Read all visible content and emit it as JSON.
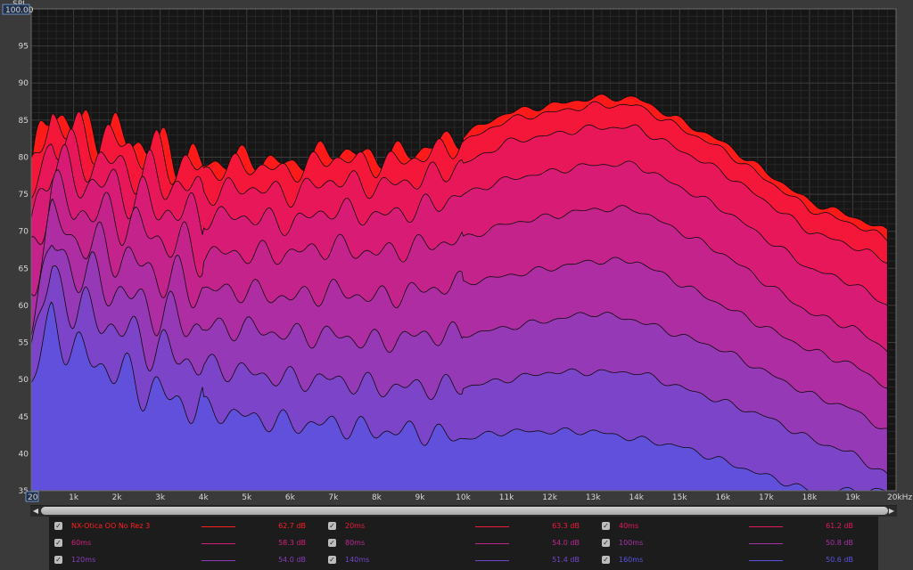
{
  "chart_data": {
    "type": "area",
    "ylabel": "SPL",
    "ylim": [
      35,
      100
    ],
    "xlim": [
      20,
      20000
    ],
    "y_ticks": [
      "100.00",
      "95",
      "90",
      "85",
      "80",
      "75",
      "70",
      "65",
      "60",
      "55",
      "50",
      "45",
      "40",
      "35"
    ],
    "x_ticks": [
      "20",
      "1k",
      "2k",
      "3k",
      "4k",
      "5k",
      "6k",
      "7k",
      "8k",
      "9k",
      "10k",
      "11k",
      "12k",
      "13k",
      "14k",
      "15k",
      "16k",
      "17k",
      "18k",
      "19k",
      "20kHz"
    ],
    "grid": true,
    "x": [
      20,
      500,
      1000,
      2000,
      3000,
      4000,
      5000,
      6000,
      7000,
      8000,
      9000,
      10000,
      11000,
      12000,
      13000,
      14000,
      15000,
      16000,
      17000,
      18000,
      19000,
      19800
    ],
    "series": [
      {
        "name": "NX-Otica OO No Rez 3",
        "color": "#ff1a1a",
        "values": [
          78,
          87,
          84,
          83,
          81,
          79,
          80,
          79,
          81,
          80,
          81,
          83,
          86,
          87,
          88,
          88,
          85,
          82,
          78,
          74,
          72,
          70
        ]
      },
      {
        "name": "20ms",
        "color": "#f5173a",
        "values": [
          77,
          86,
          83,
          82,
          80,
          78,
          79,
          78,
          80,
          79,
          80,
          82,
          85,
          86,
          87,
          87,
          84,
          81,
          77,
          73,
          71,
          69
        ]
      },
      {
        "name": "40ms",
        "color": "#e8175a",
        "values": [
          74,
          83,
          80,
          79,
          77,
          75,
          76,
          75,
          77,
          76,
          77,
          79,
          82,
          83,
          84,
          84,
          81,
          78,
          74,
          70,
          68,
          66
        ]
      },
      {
        "name": "60ms",
        "color": "#d81c75",
        "values": [
          71,
          80,
          77,
          76,
          73,
          72,
          72,
          71,
          73,
          72,
          73,
          75,
          77,
          78,
          79,
          79,
          76,
          73,
          69,
          65,
          63,
          60
        ]
      },
      {
        "name": "80ms",
        "color": "#c5238c",
        "values": [
          67,
          76,
          73,
          72,
          69,
          67,
          67,
          67,
          68,
          67,
          68,
          69,
          71,
          72,
          73,
          73,
          70,
          67,
          63,
          59,
          57,
          54
        ]
      },
      {
        "name": "100ms",
        "color": "#ae2da2",
        "values": [
          63,
          72,
          69,
          67,
          64,
          62,
          62,
          61,
          62,
          61,
          62,
          63,
          64,
          65,
          66,
          66,
          63,
          60,
          57,
          54,
          52,
          49
        ]
      },
      {
        "name": "120ms",
        "color": "#9639b6",
        "values": [
          59,
          68,
          65,
          62,
          59,
          57,
          57,
          56,
          56,
          55,
          56,
          56,
          57,
          58,
          59,
          58,
          56,
          54,
          51,
          48,
          46,
          43
        ]
      },
      {
        "name": "140ms",
        "color": "#7c44c9",
        "values": [
          55,
          64,
          60,
          57,
          54,
          52,
          51,
          50,
          50,
          49,
          49,
          49,
          50,
          51,
          51,
          51,
          49,
          47,
          45,
          42,
          40,
          37
        ]
      },
      {
        "name": "160ms",
        "color": "#6150dc",
        "values": [
          50,
          58,
          54,
          51,
          48,
          46,
          45,
          44,
          44,
          43,
          43,
          42,
          43,
          43,
          43,
          42,
          41,
          39,
          37,
          35,
          35,
          35
        ]
      }
    ]
  },
  "legend": [
    {
      "name": "NX-Otica OO No Rez 3",
      "value": "62.7 dB",
      "color": "#ff2020",
      "checked": "✓"
    },
    {
      "name": "20ms",
      "value": "63.3 dB",
      "color": "#f21a3d",
      "checked": "✓"
    },
    {
      "name": "40ms",
      "value": "61.2 dB",
      "color": "#e31a5c",
      "checked": "✓"
    },
    {
      "name": "60ms",
      "value": "58.3 dB",
      "color": "#d0207a",
      "checked": "✓"
    },
    {
      "name": "80ms",
      "value": "54.0 dB",
      "color": "#bb2890",
      "checked": "✓"
    },
    {
      "name": "100ms",
      "value": "50.8 dB",
      "color": "#a532a6",
      "checked": "✓"
    },
    {
      "name": "120ms",
      "value": "54.0 dB",
      "color": "#8c3cbb",
      "checked": "✓"
    },
    {
      "name": "140ms",
      "value": "51.4 dB",
      "color": "#7246cd",
      "checked": "✓"
    },
    {
      "name": "160ms",
      "value": "50.6 dB",
      "color": "#5a52e0",
      "checked": "✓"
    }
  ],
  "scrollbar": {
    "left_arrow": "◀",
    "right_arrow": "▶"
  }
}
